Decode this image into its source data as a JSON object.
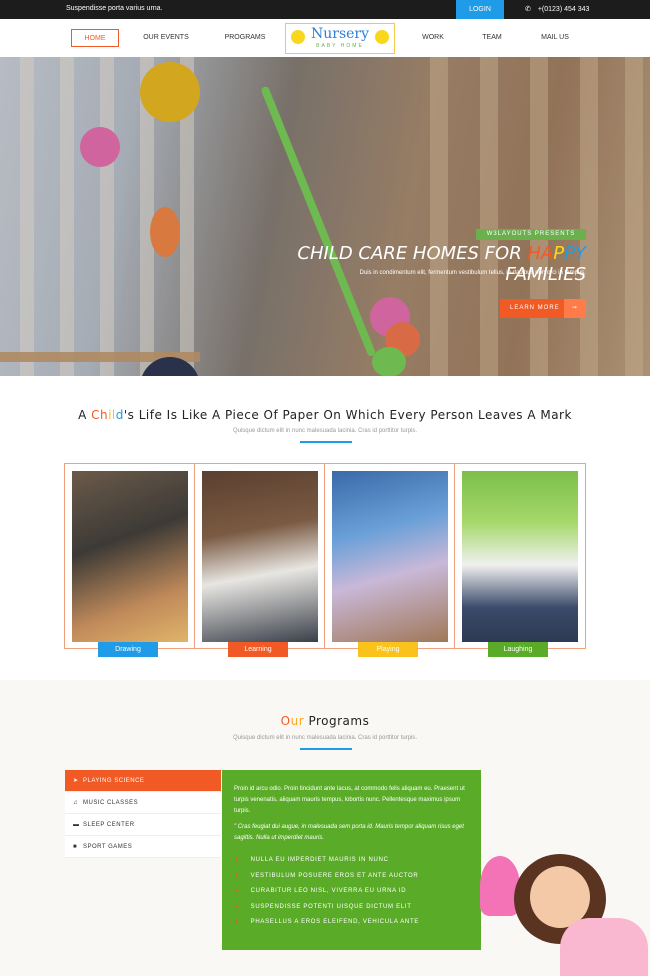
{
  "topbar": {
    "tagline": "Suspendisse porta varius urna.",
    "login": "LOGIN",
    "phone_icon": "phone-icon",
    "phone": "+(0123) 454 343"
  },
  "nav": {
    "items": [
      "HOME",
      "OUR EVENTS",
      "PROGRAMS",
      "WORK",
      "TEAM",
      "MAIL US"
    ],
    "logo_title": "Nursery",
    "logo_sub": "BABY HOME"
  },
  "hero": {
    "presents": "W3LAYOUTS PRESENTS",
    "title_pre": "CHILD CARE HOMES FOR ",
    "title_h": "HA",
    "title_p1": "P",
    "title_p2": "PY",
    "title_post": " FAMILIES",
    "subtitle": "Duis in condimentum elit, fermentum vestibulum tellus, in dapibus non orci in tempus.",
    "button": "LEARN MORE",
    "button_icon": "arrow-right-icon"
  },
  "intro": {
    "t1": "A ",
    "t_ch": "Ch",
    "t_il": "il",
    "t_d": "d",
    "t2": "'s Life Is Like A Piece Of Paper On Which Every Person Leaves A Mark",
    "subtitle": "Quisque dictum elit in nunc malesuada lacinia. Cras id porttitor turpis."
  },
  "gallery": [
    {
      "caption": "Drawing",
      "color": "#1e9ce8"
    },
    {
      "caption": "Learning",
      "color": "#f15a24"
    },
    {
      "caption": "Playing",
      "color": "#f9c31c"
    },
    {
      "caption": "Laughing",
      "color": "#5aac28"
    }
  ],
  "programs": {
    "title_o": "O",
    "title_ur": "ur",
    "title_rest": " Programs",
    "subtitle": "Quisque dictum elit in nunc malesuada lacinia. Cras id porttitor turpis.",
    "tabs": [
      {
        "label": "PLAYING SCIENCE",
        "icon": "rocket-icon"
      },
      {
        "label": "MUSIC CLASSES",
        "icon": "music-icon"
      },
      {
        "label": "SLEEP CENTER",
        "icon": "bed-icon"
      },
      {
        "label": "SPORT GAMES",
        "icon": "gamepad-icon"
      }
    ],
    "para": "Proin id arcu odio. Proin tincidunt ante lacus, at commodo felis aliquam eu. Praesent ut turpis venenatis, aliquam mauris tempus, lobortis nunc. Pellentesque maximus ipsum turpis.",
    "quote": "\" Cras feugiat dui augue, in malesuada sem porta id. Mauris tempor aliquam risus eget sagittis. Nulla ut imperdiet mauris.",
    "list": [
      "NULLA EU IMPERDIET MAURIS IN NUNC",
      "VESTIBULUM POSUERE EROS ET ANTE AUCTOR",
      "CURABITUR LEO NISL, VIVERRA EU URNA ID",
      "SUSPENDISSE POTENTI UISQUE DICTUM ELIT",
      "PHASELLUS A EROS ELEIFEND, VEHICULA ANTE"
    ]
  }
}
